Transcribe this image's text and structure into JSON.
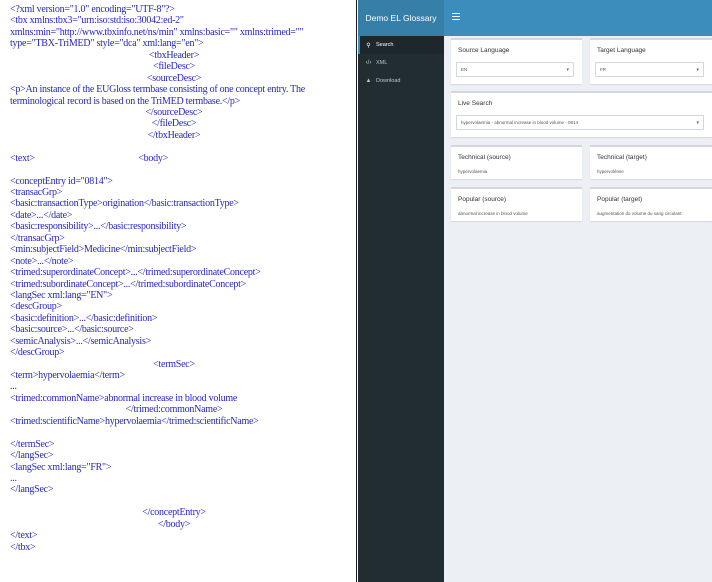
{
  "xml_document": {
    "lines": [
      {
        "t": "<?xml version=\"1.0\" encoding=\"UTF-8\"?>"
      },
      {
        "t": "<tbx xmlns:tbx3=\"urn:iso:std:iso:30042:ed-2\""
      },
      {
        "t": "xmlns:min=\"http://www.tbxinfo.net/ns/min\" xmlns:basic=\"\" xmlns:trimed=\"\""
      },
      {
        "t": "type=\"TBX-TriMED\" style=\"dca\" xml:lang=\"en\">"
      },
      {
        "t": "<tbxHeader>",
        "c": true
      },
      {
        "t": "<fileDesc>",
        "c": true
      },
      {
        "t": "<sourceDesc>",
        "c": true
      },
      {
        "t": "<p>An instance of the EUGloss termbase consisting of one concept entry. The"
      },
      {
        "t": "terminological record is based on the TriMED termbase.</p>"
      },
      {
        "t": "</sourceDesc>",
        "c": true
      },
      {
        "t": "</fileDesc>",
        "c": true
      },
      {
        "t": "</tbxHeader>",
        "c": true
      },
      {
        "t": ""
      },
      {
        "t": "<text>                                              <body>"
      },
      {
        "t": ""
      },
      {
        "t": "<conceptEntry id=\"0814\">"
      },
      {
        "t": "<transacGrp>"
      },
      {
        "t": "<basic:transactionType>origination</basic:transactionType>"
      },
      {
        "t": "<date>...</date>"
      },
      {
        "t": "<basic:responsibility>...</basic:responsibility>"
      },
      {
        "t": "</transacGrp>"
      },
      {
        "t": "<min:subjectField>Medicine</min:subjectField>"
      },
      {
        "t": "<note>...</note>"
      },
      {
        "t": "<trimed:superordinateConcept>...</trimed:superordinateConcept>"
      },
      {
        "t": "<trimed:subordinateConcept>...</trimed:subordinateConcept>"
      },
      {
        "t": "<langSec xml:lang=\"EN\">"
      },
      {
        "t": "<descGroup>"
      },
      {
        "t": "<basic:definition>...</basic:definition>"
      },
      {
        "t": "<basic:source>...</basic:source>"
      },
      {
        "t": "<semicAnalysis>...</semicAnalysis>"
      },
      {
        "t": "</descGroup>"
      },
      {
        "t": "<termSec>",
        "c": true
      },
      {
        "t": "<term>hypervolaemia</term>"
      },
      {
        "t": "..."
      },
      {
        "t": "<trimed:commonName>abnormal increase in blood volume"
      },
      {
        "t": "</trimed:commonName>",
        "c": true
      },
      {
        "t": "<trimed:scientificName>hypervolaemia</trimed:scientificName>"
      },
      {
        "t": ""
      },
      {
        "t": "</termSec>"
      },
      {
        "t": "</langSec>"
      },
      {
        "t": "<langSec xml:lang=\"FR\">"
      },
      {
        "t": "..."
      },
      {
        "t": "</langSec>"
      },
      {
        "t": ""
      },
      {
        "t": "</conceptEntry>",
        "c": true
      },
      {
        "t": "</body>",
        "c": true
      },
      {
        "t": "</text>"
      },
      {
        "t": "</tbx>"
      }
    ]
  },
  "app": {
    "title": "Demo EL Glossary",
    "sidebar": [
      {
        "icon": "⚲",
        "label": "Search",
        "active": true
      },
      {
        "icon": "‹/›",
        "label": "XML",
        "active": false
      },
      {
        "icon": "▲",
        "label": "Download",
        "active": false
      }
    ],
    "source_language": {
      "label": "Source Language",
      "value": "EN"
    },
    "target_language": {
      "label": "Target Language",
      "value": "FR"
    },
    "live_search": {
      "label": "Live Search",
      "value": "hypervolaemia - abnormal increase in blood volume - 0814"
    },
    "technical_source": {
      "label": "Technical (source)",
      "value": "hypervolaemia"
    },
    "technical_target": {
      "label": "Technical (target)",
      "value": "hypervolémie"
    },
    "popular_source": {
      "label": "Popular (source)",
      "value": "abnormal increase in blood volume"
    },
    "popular_target": {
      "label": "Popular (target)",
      "value": "augmentation du volume du sang circulant"
    },
    "colors": {
      "header": "#3c8dbc",
      "logo": "#367fa9",
      "sidebar": "#222d32",
      "content": "#ecf0f5",
      "xml_text": "#2626c0"
    }
  }
}
